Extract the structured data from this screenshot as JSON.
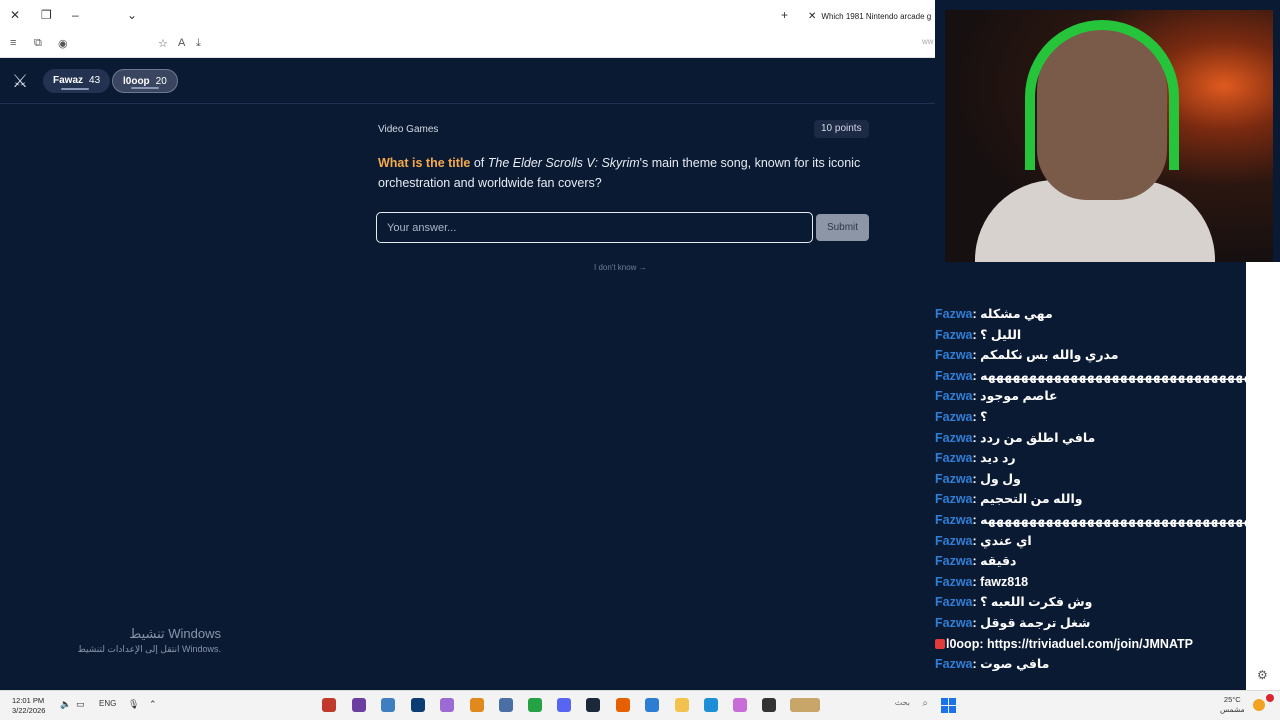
{
  "browser": {
    "tab_title": "Which 1981 Nintendo arcade g",
    "address_hint": "ww"
  },
  "players": [
    {
      "name": "Fawaz",
      "score": "43"
    },
    {
      "name": "l0oop",
      "score": "20"
    }
  ],
  "question": {
    "category": "Video Games",
    "points": "10 points",
    "highlight": "What is the title",
    "part1": " of ",
    "italic": "The Elder Scrolls V: Skyrim",
    "part2": "'s main theme song, known for its iconic orchestration and worldwide fan covers?"
  },
  "answer": {
    "placeholder": "Your answer...",
    "submit_label": "Submit",
    "dont_know": "I don't know →"
  },
  "windows_activation": {
    "title": "تنشيط Windows",
    "subtitle": "انتقل إلى الإعدادات لتنشيط Windows."
  },
  "chat": [
    {
      "user": "Fazwa",
      "message": "مهي مشكله"
    },
    {
      "user": "Fazwa",
      "message": "الليل ؟"
    },
    {
      "user": "Fazwa",
      "message": "مدري والله بس نكلمكم"
    },
    {
      "user": "Fazwa",
      "message": "هههههههههههههههههههههههههههههههههههههههه"
    },
    {
      "user": "Fazwa",
      "message": "عاصم موجود"
    },
    {
      "user": "Fazwa",
      "message": "؟"
    },
    {
      "user": "Fazwa",
      "message": "مافي اطلق من ردد"
    },
    {
      "user": "Fazwa",
      "message": "رد ديد"
    },
    {
      "user": "Fazwa",
      "message": "ول ول"
    },
    {
      "user": "Fazwa",
      "message": "والله من التحجيم"
    },
    {
      "user": "Fazwa",
      "message": "هههههههههههههههههههههههههههههههههههههههه"
    },
    {
      "user": "Fazwa",
      "message": "اي عندي"
    },
    {
      "user": "Fazwa",
      "message": "دقيقه"
    },
    {
      "user": "Fazwa",
      "message": "fawz818"
    },
    {
      "user": "Fazwa",
      "message": "وش فكرت اللعبه ؟"
    },
    {
      "user": "Fazwa",
      "message": "شغل ترجمة قوقل"
    },
    {
      "user": "l0oop",
      "message": "https://triviaduel.com/join/JMNATP"
    },
    {
      "user": "Fazwa",
      "message": "مافي صوت"
    }
  ],
  "taskbar": {
    "time": "12:01 PM",
    "date": "3/22/2026",
    "language": "ENG",
    "search_placeholder": "بحث",
    "temperature": "25°C",
    "weather_text": "مشمس"
  },
  "colors": {
    "background": "#0b1a33",
    "accent_orange": "#f6a94a",
    "chat_user_blue": "#2f7fd6"
  }
}
